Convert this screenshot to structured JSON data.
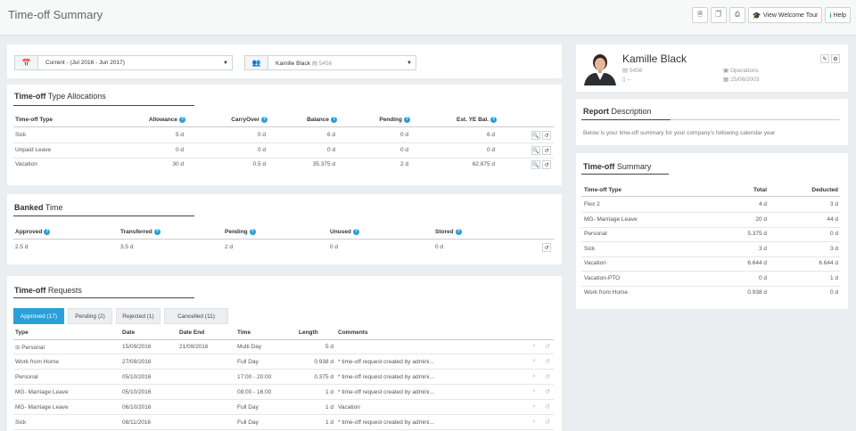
{
  "page": {
    "title": "Time-off Summary"
  },
  "toolbar": {
    "pdf_icon": "pdf-file-icon",
    "xls_icon": "excel-file-icon",
    "print_icon": "print-icon",
    "tour_label": "View Welcome Tour",
    "help_label": "Help"
  },
  "filters": {
    "period": "Current - (Jul 2016 - Jun 2017)",
    "employee_name": "Kamille Black",
    "employee_id": "5456"
  },
  "allocations": {
    "title_bold": "Time-off",
    "title_rest": " Type Allocations",
    "headers": [
      "Time-off Type",
      "Allowance",
      "CarryOver",
      "Balance",
      "Pending",
      "Est. YE Bal."
    ],
    "rows": [
      [
        "Sick",
        "5 d",
        "0 d",
        "6 d",
        "0 d",
        "6 d"
      ],
      [
        "Unpaid Leave",
        "0 d",
        "0 d",
        "0 d",
        "0 d",
        "0 d"
      ],
      [
        "Vacation",
        "30 d",
        "0.5 d",
        "35.375 d",
        "2 d",
        "62.875 d"
      ]
    ]
  },
  "banked": {
    "title_bold": "Banked",
    "title_rest": " Time",
    "headers": [
      "Approved",
      "Transferred",
      "Pending",
      "Unused",
      "Stored"
    ],
    "values": [
      "2.5 d",
      "3.5 d",
      "2 d",
      "0 d",
      "0 d"
    ]
  },
  "requests": {
    "title_bold": "Time-off",
    "title_rest": " Requests",
    "tabs": [
      "Approved (17)",
      "Pending (2)",
      "Rejected (1)",
      "Cancelled (11)"
    ],
    "headers": [
      "Type",
      "Date",
      "Date End",
      "Time",
      "Length",
      "Comments"
    ],
    "rows": [
      [
        "Personal",
        "15/09/2016",
        "21/09/2016",
        "Multi Day",
        "5 d",
        ""
      ],
      [
        "Work from Home",
        "27/09/2016",
        "",
        "Full Day",
        "0.938 d",
        "* time-off request created by admini..."
      ],
      [
        "Personal",
        "05/10/2016",
        "",
        "17:00 - 20:00",
        "0.375 d",
        "* time-off request created by admini..."
      ],
      [
        "MG- Marriage Leave",
        "05/10/2016",
        "",
        "08:00 - 16:00",
        "1 d",
        "* time-off request created by admini..."
      ],
      [
        "MG- Marriage Leave",
        "06/10/2016",
        "",
        "Full Day",
        "1 d",
        "Vacation"
      ],
      [
        "Sick",
        "08/11/2016",
        "",
        "Full Day",
        "1 d",
        "* time-off request created by admini..."
      ]
    ]
  },
  "profile": {
    "name": "Kamille Black",
    "id": "5456",
    "phone": "--",
    "department": "Operations",
    "start_date": "25/08/2003"
  },
  "report": {
    "title_bold": "Report",
    "title_rest": " Description",
    "text": "Below is your time-off summary for your company's following calendar year"
  },
  "summary": {
    "title_bold": "Time-off",
    "title_rest": " Summary",
    "headers": [
      "Time-off Type",
      "Total",
      "Deducted"
    ],
    "rows": [
      [
        "Flex 2",
        "4 d",
        "3 d"
      ],
      [
        "MG- Marriage Leave",
        "20 d",
        "44 d"
      ],
      [
        "Personal",
        "5.375 d",
        "0 d"
      ],
      [
        "Sick",
        "3 d",
        "3 d"
      ],
      [
        "Vacation",
        "6.644 d",
        "6.644 d"
      ],
      [
        "Vacation-PTO",
        "0 d",
        "1 d"
      ],
      [
        "Work from Home",
        "0.938 d",
        "0 d"
      ]
    ]
  }
}
